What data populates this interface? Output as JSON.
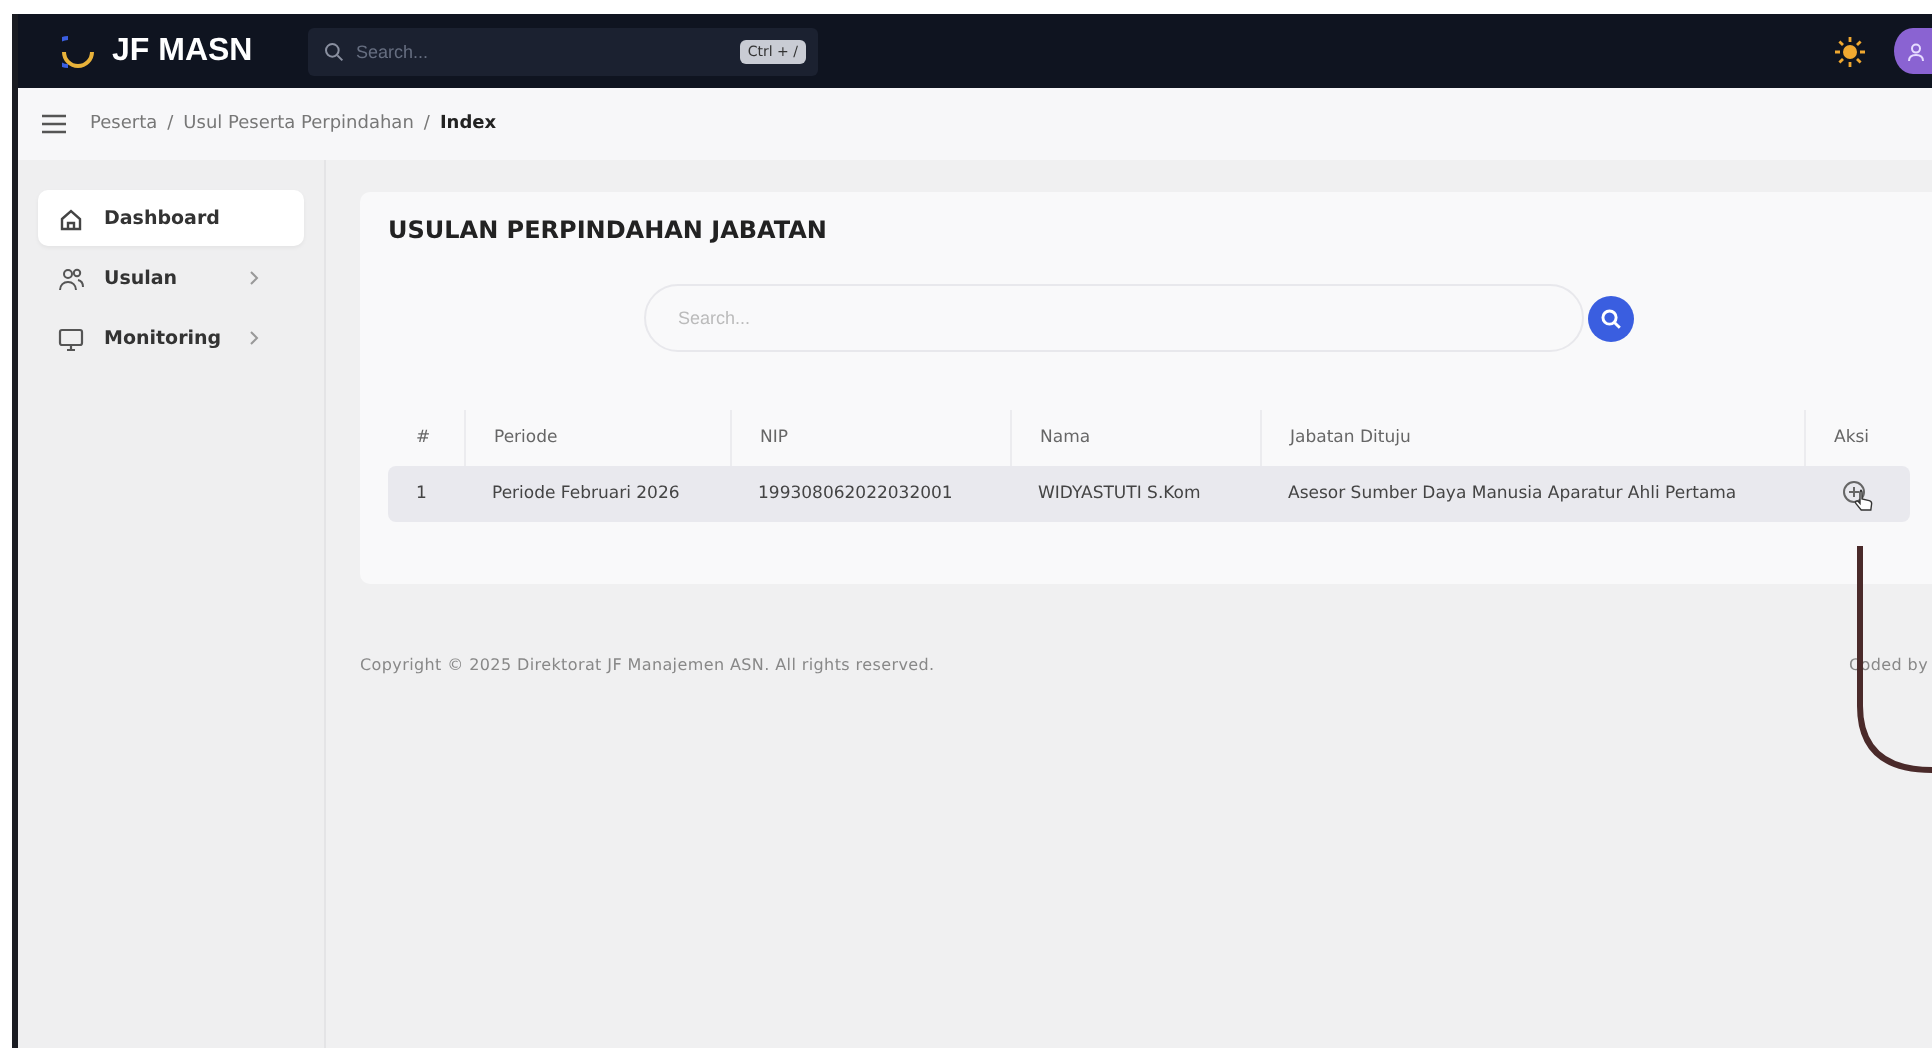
{
  "navbar": {
    "brand": "JF MASN",
    "search": {
      "placeholder": "Search..."
    },
    "shortcut": "Ctrl + /"
  },
  "breadcrumb": [
    {
      "label": "Peserta",
      "current": false
    },
    {
      "separator": "/",
      "label": "Usul Peserta Perpindahan",
      "current": false
    },
    {
      "separator": "/",
      "label": "Index",
      "current": true
    }
  ],
  "sidebar": {
    "items": [
      {
        "label": "Dashboard",
        "selected": true,
        "has_children": false
      },
      {
        "label": "Usulan",
        "selected": false,
        "has_children": true
      },
      {
        "label": "Monitoring",
        "selected": false,
        "has_children": true
      }
    ]
  },
  "card": {
    "title": "USULAN PERPINDAHAN JABATAN",
    "search": {
      "placeholder": "Search..."
    },
    "table": {
      "columns": [
        "#",
        "Periode",
        "NIP",
        "Nama",
        "Jabatan Dituju",
        "Aksi"
      ],
      "rows": [
        {
          "cells": [
            "1",
            "Periode Februari 2026",
            "199308062022032001",
            "WIDYASTUTI S.Kom",
            "Asesor Sumber Daya Manusia Aparatur Ahli Pertama"
          ]
        }
      ]
    }
  },
  "footer": {
    "copyright": "Copyright © 2025 Direktorat JF Manajemen ASN. All rights reserved.",
    "credit": "Coded by"
  }
}
